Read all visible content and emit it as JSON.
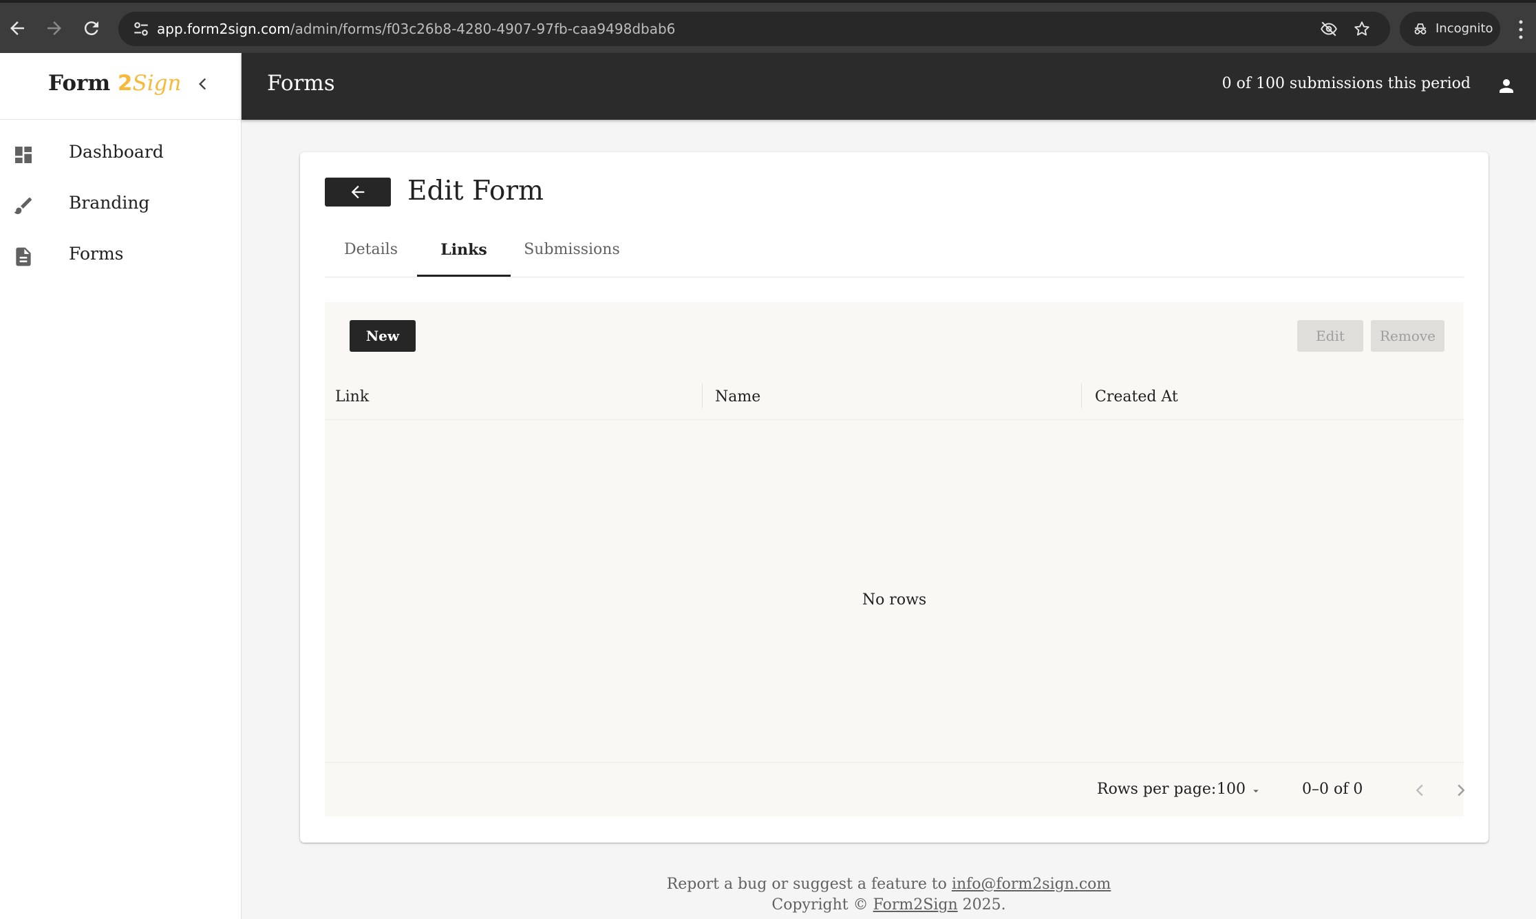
{
  "browser": {
    "url_host": "app.form2sign.com",
    "url_path": "/admin/forms/f03c26b8-4280-4907-97fb-caa9498dbab6",
    "profile_label": "Incognito"
  },
  "sidebar": {
    "logo": {
      "part1": "Form",
      "part2": "2",
      "part3": "Sign"
    },
    "items": [
      {
        "label": "Dashboard",
        "icon": "dashboard-icon"
      },
      {
        "label": "Branding",
        "icon": "brush-icon"
      },
      {
        "label": "Forms",
        "icon": "document-icon"
      }
    ]
  },
  "appbar": {
    "title": "Forms",
    "quota": "0 of 100 submissions this period"
  },
  "card": {
    "title": "Edit Form",
    "tabs": [
      {
        "label": "Details",
        "active": false
      },
      {
        "label": "Links",
        "active": true
      },
      {
        "label": "Submissions",
        "active": false
      }
    ]
  },
  "grid": {
    "new_label": "New",
    "edit_label": "Edit",
    "remove_label": "Remove",
    "columns": [
      "Link",
      "Name",
      "Created At"
    ],
    "empty_text": "No rows",
    "rows_per_page_label": "Rows per page:",
    "rows_per_page_value": "100",
    "range_text": "0–0 of 0"
  },
  "footer": {
    "report_text": "Report a bug or suggest a feature to",
    "email": "info@form2sign.com",
    "copyright_prefix": "Copyright ©",
    "company": "Form2Sign",
    "year_suffix": "2025."
  },
  "colors": {
    "accent": "#f6b93b",
    "dark": "#262626",
    "appbar": "#2b2b2b"
  }
}
